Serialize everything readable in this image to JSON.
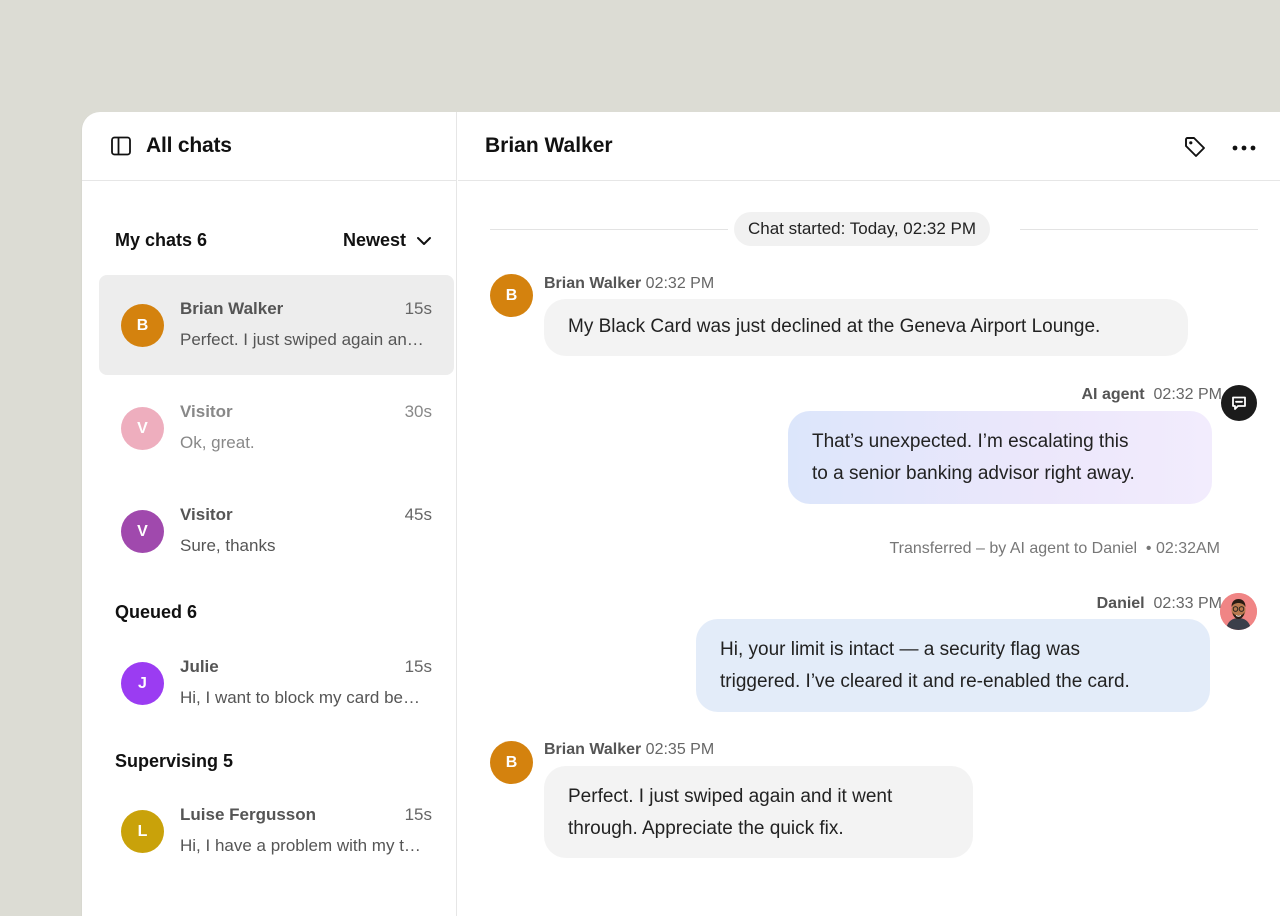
{
  "sidebar": {
    "title": "All chats",
    "sort_label": "Newest",
    "sections": {
      "my_chats": "My chats 6",
      "queued": "Queued 6",
      "supervising": "Supervising 5"
    },
    "chats": [
      {
        "initial": "B",
        "name": "Brian Walker",
        "time": "15s",
        "preview": "Perfect. I just swiped again and it went through.",
        "color": "#d4820e"
      },
      {
        "initial": "V",
        "name": "Visitor",
        "time": "30s",
        "preview": "Ok, great.",
        "color": "#eeaebe"
      },
      {
        "initial": "V",
        "name": "Visitor",
        "time": "45s",
        "preview": "Sure, thanks",
        "color": "#a049ad"
      },
      {
        "initial": "J",
        "name": "Julie",
        "time": "15s",
        "preview": "Hi, I want to block my card because I lost it",
        "color": "#9b3cf2"
      },
      {
        "initial": "L",
        "name": "Luise Fergusson",
        "time": "15s",
        "preview": "Hi, I have a problem with my transfer",
        "color": "#c9a20a"
      }
    ]
  },
  "conversation": {
    "title": "Brian Walker",
    "started": "Chat started: Today, 02:32 PM",
    "messages": [
      {
        "sender": "Brian Walker",
        "time": "02:32 PM",
        "initial": "B",
        "text": "My Black Card was just declined at the Geneva Airport Lounge."
      },
      {
        "sender": "AI agent",
        "time": "02:32 PM",
        "text_line1": "That’s unexpected. I’m escalating this",
        "text_line2": "to a senior banking advisor right away."
      },
      {
        "sender": "Daniel",
        "time": "02:33 PM",
        "text_line1": "Hi, your limit is intact — a security flag was",
        "text_line2": "triggered. I’ve cleared it and re-enabled the card."
      },
      {
        "sender": "Brian Walker",
        "time": "02:35 PM",
        "initial": "B",
        "text_line1": "Perfect. I just swiped again and it went",
        "text_line2": "through. Appreciate the quick fix."
      }
    ],
    "transfer_note": "Transferred – by AI agent to Daniel",
    "transfer_time": "• 02:32AM"
  },
  "colors": {
    "customer_avatar": "#d4820e",
    "ai_icon_bg": "#1b1b1b",
    "agent_avatar_bg": "#f08585"
  },
  "icons": [
    "sidebar-panel-icon",
    "chevron-down-icon",
    "tag-icon",
    "more-horizontal-icon",
    "ai-chat-icon"
  ]
}
